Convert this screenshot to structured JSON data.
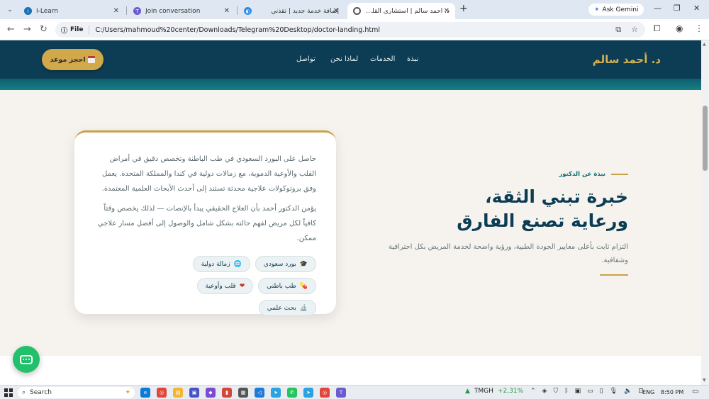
{
  "browser": {
    "tabs": [
      {
        "title": "I-Learn",
        "active": false
      },
      {
        "title": "Join conversation",
        "active": false
      },
      {
        "title": "",
        "active": false
      },
      {
        "title": "إضافة خدمة جديد | تقذني",
        "active": false
      },
      {
        "title": "د. أحمد سالم | استشاري القلب والأ",
        "active": true
      }
    ],
    "gemini_label": "Ask Gemini",
    "file_chip": "File",
    "url": "C:/Users/mahmoud%20center/Downloads/Telegram%20Desktop/doctor-landing.html"
  },
  "site": {
    "brand": "د. أحمد سالم",
    "nav": [
      "نبذة",
      "الخدمات",
      "لماذا نحن",
      "تواصل"
    ],
    "book_button": "احجز موعد"
  },
  "about": {
    "eyebrow": "نبذة عن الدكتور",
    "heading_line1": "خبرة تبني الثقة،",
    "heading_line2": "ورعاية تصنع الفارق",
    "lead": "التزام ثابت بأعلى معايير الجودة الطبية، ورؤية واضحة لخدمة المريض بكل احترافية وشفافية.",
    "card_p1": "حاصل على البورد السعودي في طب الباطنة وتخصص دقيق في أمراض القلب والأوعية الدموية، مع زمالات دولية في كندا والمملكة المتحدة. يعمل وفق بروتوكولات علاجية محدثة تستند إلى أحدث الأبحاث العلمية المعتمدة.",
    "card_p2": "يؤمن الدكتور أحمد بأن العلاج الحقيقي يبدأ بالإنصات — لذلك يخصص وقتاً كافياً لكل مريض لفهم حالته بشكل شامل والوصول إلى أفضل مسار علاجي ممكن.",
    "tags": [
      {
        "icon": "graduation-cap-icon",
        "glyph": "🎓",
        "label": "بورد سعودي"
      },
      {
        "icon": "globe-icon",
        "glyph": "🌐",
        "label": "زمالة دولية"
      },
      {
        "icon": "pill-icon",
        "glyph": "💊",
        "label": "طب باطني"
      },
      {
        "icon": "heart-icon",
        "glyph": "❤",
        "label": "قلب وأوعية"
      },
      {
        "icon": "microscope-icon",
        "glyph": "🔬",
        "label": "بحث علمي"
      }
    ]
  },
  "taskbar": {
    "search_placeholder": "Search",
    "ticker": "TMGH",
    "ticker_change": "+2,31%",
    "language": "ENG",
    "time": "8:50 PM"
  },
  "colors": {
    "header": "#0c3d54",
    "gold": "#d1a84a",
    "teal": "#157f85",
    "cream": "#f6f3ee",
    "chat_green": "#21c16b"
  }
}
